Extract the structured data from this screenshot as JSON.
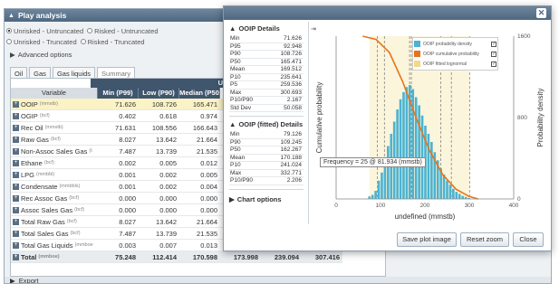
{
  "panel": {
    "title": "Play analysis"
  },
  "radios": [
    {
      "label": "Unrisked - Untruncated",
      "checked": true
    },
    {
      "label": "Risked - Untruncated",
      "checked": false
    },
    {
      "label": "Unrisked - Truncated",
      "checked": false
    },
    {
      "label": "Risked - Truncated",
      "checked": false
    }
  ],
  "advanced": "Advanced options",
  "tabs": [
    "Oil",
    "Gas",
    "Gas liquids",
    "Summary"
  ],
  "table": {
    "group_header": "Unrisked - Un",
    "columns": [
      "Variable",
      "Min (P99)",
      "Low (P90)",
      "Median (P50"
    ],
    "rows": [
      {
        "name": "OOIP",
        "unit": "(mmstb)",
        "v": [
          "71.626",
          "108.726",
          "165.471"
        ],
        "selected": true
      },
      {
        "name": "OGIP",
        "unit": "(bcf)",
        "v": [
          "0.402",
          "0.618",
          "0.974"
        ]
      },
      {
        "name": "Rec Oil",
        "unit": "(mmstb)",
        "v": [
          "71.631",
          "108.556",
          "166.643"
        ]
      },
      {
        "name": "Raw Gas",
        "unit": "(bcf)",
        "v": [
          "8.027",
          "13.642",
          "21.664"
        ]
      },
      {
        "name": "Non-Assoc Sales Gas",
        "unit": "(t",
        "v": [
          "7.487",
          "13.739",
          "21.535"
        ]
      },
      {
        "name": "Ethane",
        "unit": "(bcf)",
        "v": [
          "0.002",
          "0.005",
          "0.012"
        ]
      },
      {
        "name": "LPG",
        "unit": "(mmbbl)",
        "v": [
          "0.001",
          "0.002",
          "0.005"
        ]
      },
      {
        "name": "Condensate",
        "unit": "(mmbbls)",
        "v": [
          "0.001",
          "0.002",
          "0.004"
        ]
      },
      {
        "name": "Rec Assoc Gas",
        "unit": "(bcf)",
        "v": [
          "0.000",
          "0.000",
          "0.000"
        ]
      },
      {
        "name": "Assoc Sales Gas",
        "unit": "(bcf)",
        "v": [
          "0.000",
          "0.000",
          "0.000"
        ]
      },
      {
        "name": "Total Raw Gas",
        "unit": "(bcf)",
        "v": [
          "8.027",
          "13.642",
          "21.664"
        ]
      },
      {
        "name": "Total Sales Gas",
        "unit": "(bcf)",
        "v": [
          "7.487",
          "13.739",
          "21.535"
        ]
      },
      {
        "name": "Total Gas Liquids",
        "unit": "(mmboe",
        "v": [
          "0.003",
          "0.007",
          "0.013"
        ]
      }
    ],
    "total": {
      "name": "Total",
      "unit": "(mmboe)",
      "v": [
        "75.248",
        "112.414",
        "170.598",
        "173.998",
        "239.094",
        "307.416"
      ]
    }
  },
  "export": "Export",
  "modal": {
    "ooip_title": "OOIP Details",
    "ooip_stats": [
      [
        "Min",
        "71.626"
      ],
      [
        "P95",
        "92.948"
      ],
      [
        "P90",
        "108.726"
      ],
      [
        "P50",
        "165.471"
      ],
      [
        "Mean",
        "169.512"
      ],
      [
        "P10",
        "235.641"
      ],
      [
        "P5",
        "259.536"
      ],
      [
        "Max",
        "300.693"
      ],
      [
        "P10/P90",
        "2.167"
      ],
      [
        "Std Dev",
        "50.058"
      ]
    ],
    "fitted_title": "OOIP (fitted) Details",
    "fitted_stats": [
      [
        "Min",
        "79.126"
      ],
      [
        "P90",
        "109.245"
      ],
      [
        "P50",
        "162.267"
      ],
      [
        "Mean",
        "170.188"
      ],
      [
        "P10",
        "241.024"
      ],
      [
        "Max",
        "332.771"
      ],
      [
        "P10/P90",
        "2.206"
      ]
    ],
    "chart_options": "Chart options",
    "buttons": {
      "save": "Save plot image",
      "reset": "Reset zoom",
      "close": "Close"
    }
  },
  "chart_data": {
    "type": "bar",
    "xlabel": "undefined (mmstb)",
    "ylabel_left": "Cumulative probability",
    "ylabel_right": "Probability density",
    "x_ticks": [
      0,
      100,
      200,
      300,
      400
    ],
    "y_right_ticks": [
      0,
      800,
      1600
    ],
    "xlim": [
      0,
      400
    ],
    "tooltip": "Frequency = 25 @ 81.934 (mmstb)",
    "legend": [
      {
        "label": "OOIP probability density",
        "color": "#4db3d0"
      },
      {
        "label": "OOIP cumulative probability",
        "color": "#e8731a"
      },
      {
        "label": "OOIP fitted lognormal",
        "color": "#f2d98a"
      }
    ],
    "bins_x": [
      75,
      82,
      89,
      96,
      103,
      110,
      117,
      124,
      131,
      138,
      145,
      152,
      159,
      166,
      173,
      180,
      187,
      194,
      201,
      208,
      215,
      222,
      229,
      236,
      243,
      250,
      257,
      264,
      271,
      278,
      285,
      292,
      299
    ],
    "bins_y": [
      25,
      40,
      80,
      180,
      260,
      380,
      520,
      640,
      760,
      880,
      980,
      1050,
      1100,
      1120,
      1080,
      1000,
      920,
      820,
      720,
      640,
      560,
      460,
      380,
      300,
      240,
      180,
      140,
      100,
      70,
      50,
      30,
      20,
      10
    ],
    "cdf_x": [
      60,
      90,
      120,
      150,
      180,
      210,
      240,
      270,
      300,
      320
    ],
    "cdf_y": [
      1.0,
      0.98,
      0.9,
      0.72,
      0.5,
      0.3,
      0.15,
      0.06,
      0.015,
      0.0
    ],
    "percentile_lines": [
      92.948,
      108.726,
      165.471,
      169.512,
      235.641,
      259.536,
      300.693
    ]
  }
}
